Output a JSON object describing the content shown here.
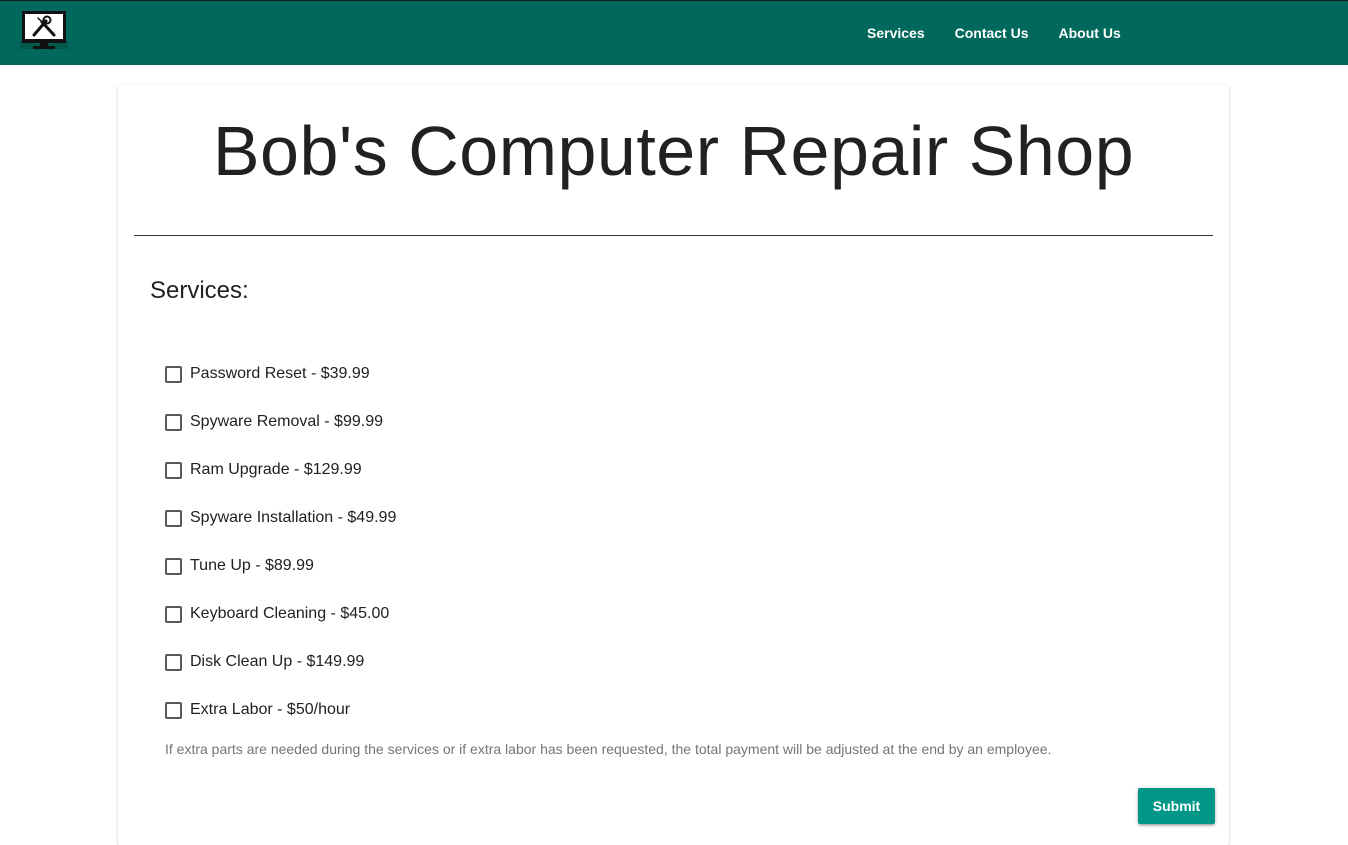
{
  "navbar": {
    "logo_icon": "computer-repair-tools-icon",
    "links": [
      {
        "label": "Services"
      },
      {
        "label": "Contact Us"
      },
      {
        "label": "About Us"
      }
    ]
  },
  "page_title": "Bob's Computer Repair Shop",
  "services": {
    "heading": "Services:",
    "items": [
      {
        "label": "Password Reset - $39.99",
        "checked": false
      },
      {
        "label": "Spyware Removal - $99.99",
        "checked": false
      },
      {
        "label": "Ram Upgrade - $129.99",
        "checked": false
      },
      {
        "label": "Spyware Installation - $49.99",
        "checked": false
      },
      {
        "label": "Tune Up - $89.99",
        "checked": false
      },
      {
        "label": "Keyboard Cleaning - $45.00",
        "checked": false
      },
      {
        "label": "Disk Clean Up - $149.99",
        "checked": false
      },
      {
        "label": "Extra Labor - $50/hour",
        "checked": false
      }
    ],
    "note": "If extra parts are needed during the services or if extra labor has been requested, the total payment will be adjusted at the end by an employee.",
    "submit_label": "Submit"
  },
  "colors": {
    "navbar": "#00695c",
    "button": "#009688",
    "text": "#212121",
    "note": "#757575"
  }
}
